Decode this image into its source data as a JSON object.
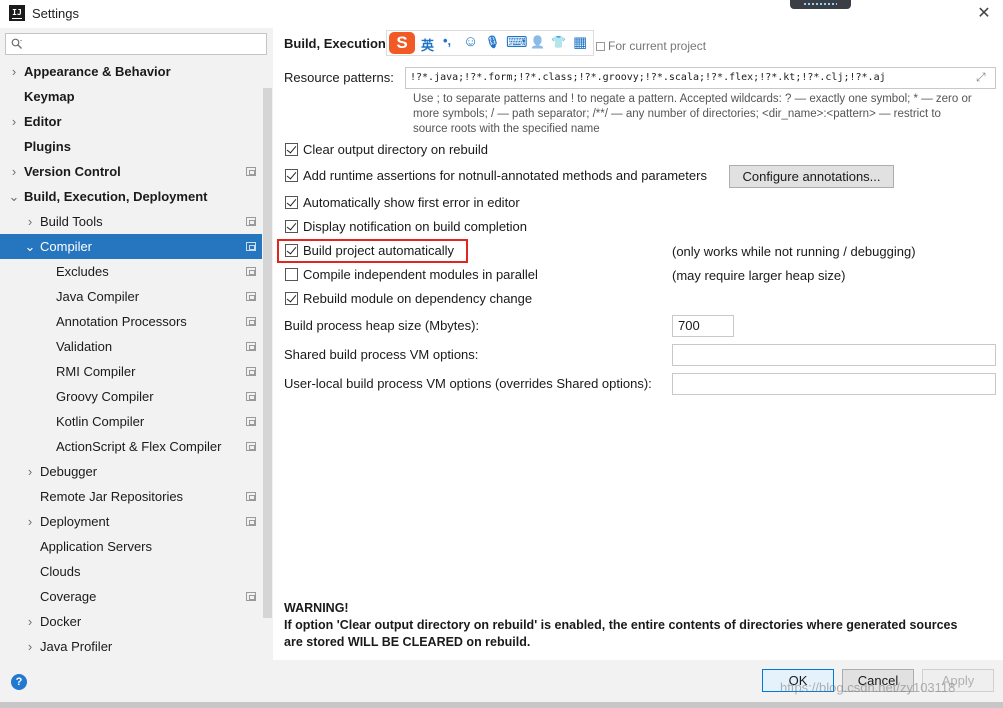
{
  "window": {
    "title": "Settings",
    "app_icon_text": "IJ",
    "close_glyph": "✕"
  },
  "search": {
    "placeholder": ""
  },
  "sidebar": {
    "items": [
      {
        "label": "Appearance & Behavior",
        "bold": true,
        "level": 0,
        "arrow": "›",
        "project": false,
        "selected": false
      },
      {
        "label": "Keymap",
        "bold": true,
        "level": 0,
        "arrow": "",
        "project": false,
        "selected": false
      },
      {
        "label": "Editor",
        "bold": true,
        "level": 0,
        "arrow": "›",
        "project": false,
        "selected": false
      },
      {
        "label": "Plugins",
        "bold": true,
        "level": 0,
        "arrow": "",
        "project": false,
        "selected": false
      },
      {
        "label": "Version Control",
        "bold": true,
        "level": 0,
        "arrow": "›",
        "project": true,
        "selected": false
      },
      {
        "label": "Build, Execution, Deployment",
        "bold": true,
        "level": 0,
        "arrow": "⌄",
        "project": false,
        "selected": false
      },
      {
        "label": "Build Tools",
        "bold": false,
        "level": 1,
        "arrow": "›",
        "project": true,
        "selected": false
      },
      {
        "label": "Compiler",
        "bold": false,
        "level": 1,
        "arrow": "⌄",
        "project": true,
        "selected": true
      },
      {
        "label": "Excludes",
        "bold": false,
        "level": 2,
        "arrow": "",
        "project": true,
        "selected": false
      },
      {
        "label": "Java Compiler",
        "bold": false,
        "level": 2,
        "arrow": "",
        "project": true,
        "selected": false
      },
      {
        "label": "Annotation Processors",
        "bold": false,
        "level": 2,
        "arrow": "",
        "project": true,
        "selected": false
      },
      {
        "label": "Validation",
        "bold": false,
        "level": 2,
        "arrow": "",
        "project": true,
        "selected": false
      },
      {
        "label": "RMI Compiler",
        "bold": false,
        "level": 2,
        "arrow": "",
        "project": true,
        "selected": false
      },
      {
        "label": "Groovy Compiler",
        "bold": false,
        "level": 2,
        "arrow": "",
        "project": true,
        "selected": false
      },
      {
        "label": "Kotlin Compiler",
        "bold": false,
        "level": 2,
        "arrow": "",
        "project": true,
        "selected": false
      },
      {
        "label": "ActionScript & Flex Compiler",
        "bold": false,
        "level": 2,
        "arrow": "",
        "project": true,
        "selected": false
      },
      {
        "label": "Debugger",
        "bold": false,
        "level": 1,
        "arrow": "›",
        "project": false,
        "selected": false
      },
      {
        "label": "Remote Jar Repositories",
        "bold": false,
        "level": 1,
        "arrow": "",
        "project": true,
        "selected": false
      },
      {
        "label": "Deployment",
        "bold": false,
        "level": 1,
        "arrow": "›",
        "project": true,
        "selected": false
      },
      {
        "label": "Application Servers",
        "bold": false,
        "level": 1,
        "arrow": "",
        "project": false,
        "selected": false
      },
      {
        "label": "Clouds",
        "bold": false,
        "level": 1,
        "arrow": "",
        "project": false,
        "selected": false
      },
      {
        "label": "Coverage",
        "bold": false,
        "level": 1,
        "arrow": "",
        "project": true,
        "selected": false
      },
      {
        "label": "Docker",
        "bold": false,
        "level": 1,
        "arrow": "›",
        "project": false,
        "selected": false
      },
      {
        "label": "Java Profiler",
        "bold": false,
        "level": 1,
        "arrow": "›",
        "project": false,
        "selected": false
      }
    ]
  },
  "main": {
    "breadcrumb": "Build, Execution,",
    "for_current_project": "For current project",
    "ime": {
      "logo": "S",
      "lang": "英",
      "punct": "•,",
      "emoji": "☺",
      "mic": "🎙",
      "keyboard": "⌨",
      "user": "👤",
      "shirt": "👕",
      "grid": "▦"
    },
    "resource_patterns": {
      "label": "Resource patterns:",
      "value": "!?*.java;!?*.form;!?*.class;!?*.groovy;!?*.scala;!?*.flex;!?*.kt;!?*.clj;!?*.aj",
      "expand_glyph": "⤢"
    },
    "hint_lines": [
      "Use ; to separate patterns and ! to negate a pattern. Accepted wildcards: ? — exactly one symbol; * — zero or",
      "more symbols; / — path separator; /**/ — any number of directories; <dir_name>:<pattern> — restrict to",
      "source roots with the specified name"
    ],
    "checkboxes": [
      {
        "label": "Clear output directory on rebuild",
        "checked": true
      },
      {
        "label": "Add runtime assertions for notnull-annotated methods and parameters",
        "checked": true
      },
      {
        "label": "Automatically show first error in editor",
        "checked": true
      },
      {
        "label": "Display notification on build completion",
        "checked": true
      },
      {
        "label": "Build project automatically",
        "checked": true
      },
      {
        "label": "Compile independent modules in parallel",
        "checked": false
      },
      {
        "label": "Rebuild module on dependency change",
        "checked": true
      }
    ],
    "configure_annotations_label": "Configure annotations...",
    "note_build_auto": "(only works while not running / debugging)",
    "note_parallel": "(may require larger heap size)",
    "heap_label": "Build process heap size (Mbytes):",
    "heap_value": "700",
    "shared_vm_label": "Shared build process VM options:",
    "shared_vm_value": "",
    "user_vm_label": "User-local build process VM options (overrides Shared options):",
    "user_vm_value": "",
    "warning_title": "WARNING!",
    "warning_lines": [
      "If option 'Clear output directory on rebuild' is enabled, the entire contents of directories where generated sources",
      "are stored WILL BE CLEARED on rebuild."
    ]
  },
  "footer": {
    "help_glyph": "?",
    "ok_label": "OK",
    "cancel_label": "Cancel",
    "apply_label": "Apply",
    "watermark": "https://blog.csdn.net/zy103118"
  },
  "colors": {
    "selection": "#2675bf",
    "highlight_box": "#e0271d",
    "sidebar_bg": "#f2f2f2",
    "ime_logo": "#f15a24",
    "ime_icons": "#1e74c6"
  }
}
